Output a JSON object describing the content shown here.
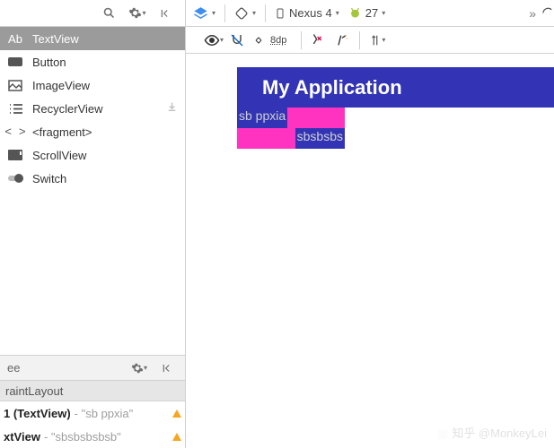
{
  "topbar": {
    "device": "Nexus 4",
    "api": "27",
    "more": "»"
  },
  "palette": {
    "items": [
      {
        "id": "textview",
        "label": "TextView",
        "selected": true
      },
      {
        "id": "button",
        "label": "Button"
      },
      {
        "id": "imageview",
        "label": "ImageView"
      },
      {
        "id": "recyclerview",
        "label": "RecyclerView",
        "download": true
      },
      {
        "id": "fragment",
        "label": "<fragment>"
      },
      {
        "id": "scrollview",
        "label": "ScrollView"
      },
      {
        "id": "switch",
        "label": "Switch"
      }
    ]
  },
  "tree": {
    "header_label": "ee",
    "root": "raintLayout",
    "rows": [
      {
        "b": "1 (TextView)",
        "g": " - \"sb ppxia\""
      },
      {
        "b": "xtView",
        "g": " - \"sbsbsbsbsb\" "
      }
    ]
  },
  "toolbar2": {
    "dp": "8dp"
  },
  "canvas": {
    "app_title": "My Application",
    "tv1_text": "sb ppxia",
    "tv2_text": "sbsbsbs"
  },
  "watermark": "知乎 @MonkeyLei"
}
